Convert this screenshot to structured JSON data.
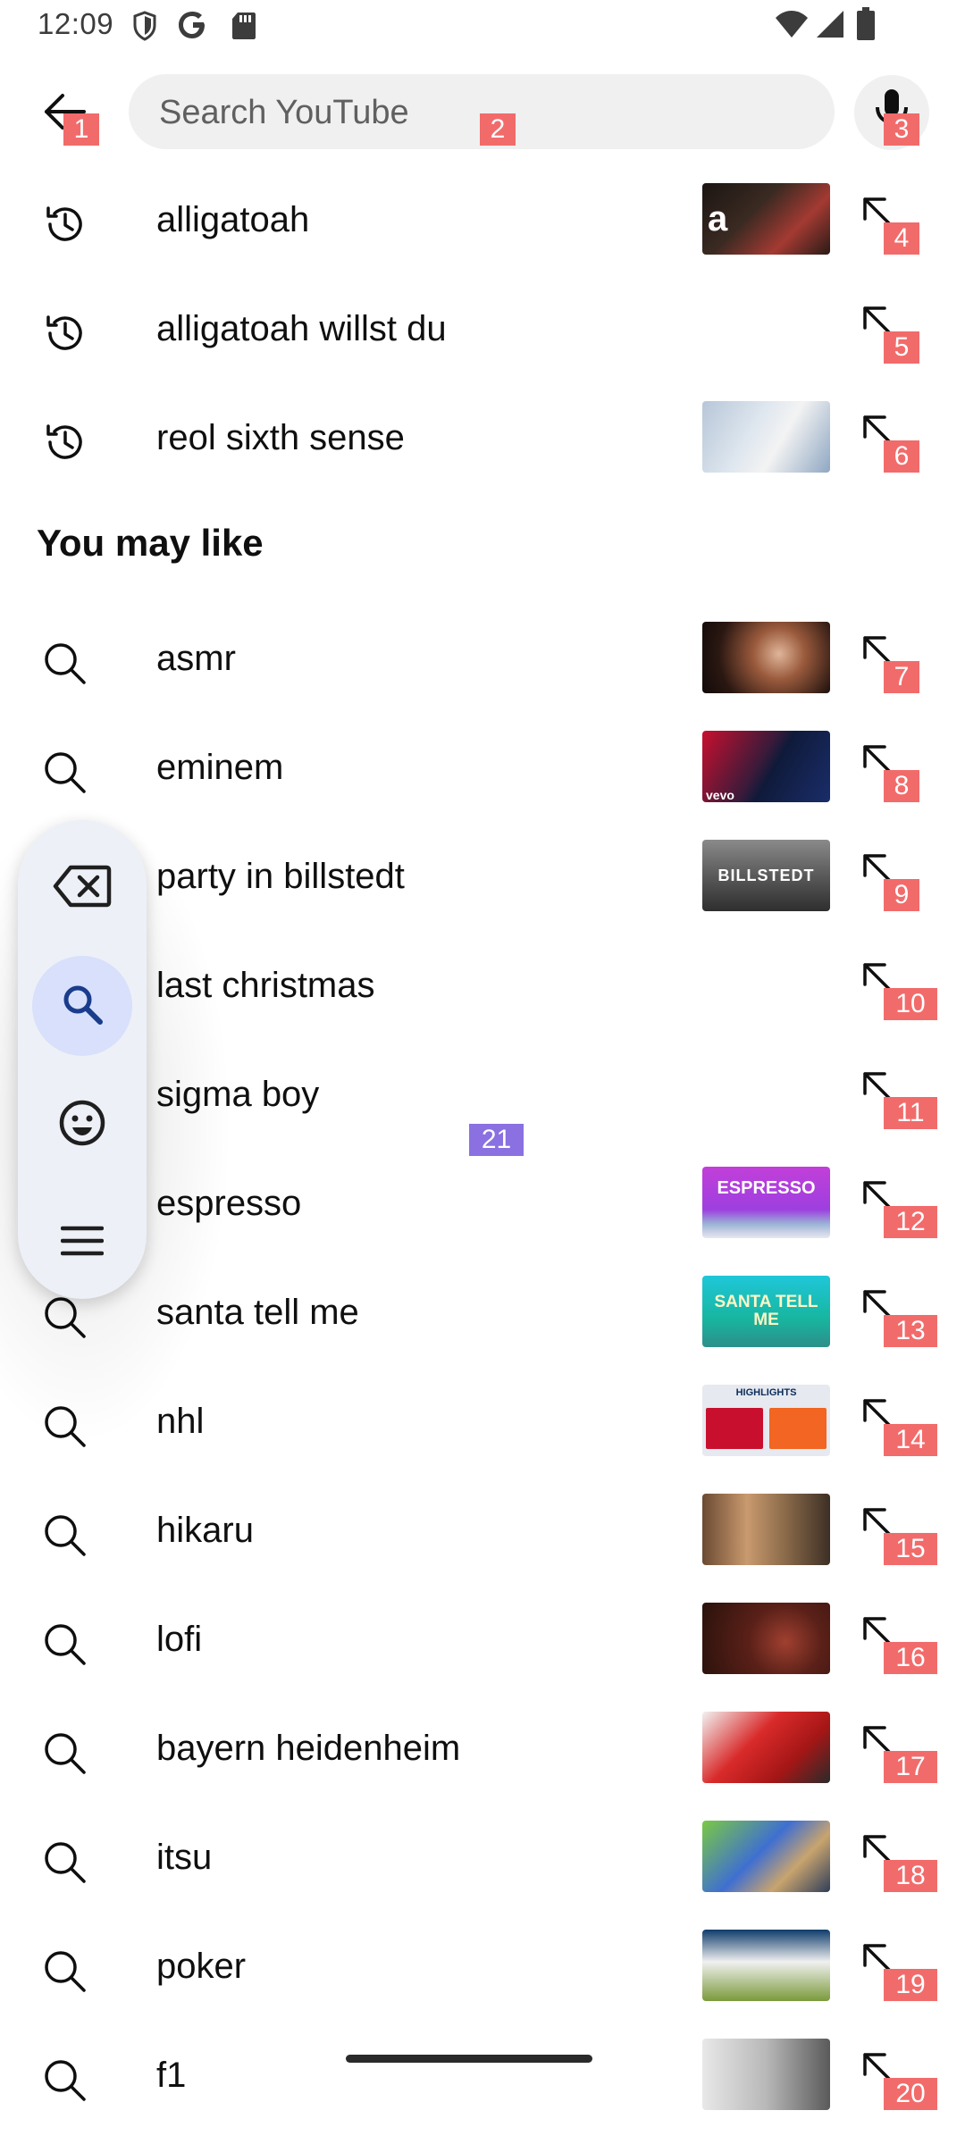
{
  "status_bar": {
    "time": "12:09",
    "left_icons": [
      "shield-icon",
      "google-icon",
      "sd-card-icon"
    ],
    "right_icons": [
      "wifi-icon",
      "signal-icon",
      "battery-icon"
    ]
  },
  "search": {
    "placeholder": "Search YouTube",
    "value": "",
    "back_icon": "arrow-left-icon",
    "mic_icon": "microphone-icon"
  },
  "history": [
    {
      "query": "alligatoah",
      "icon": "history-icon",
      "thumbnail": true,
      "badge": "4"
    },
    {
      "query": "alligatoah willst du",
      "icon": "history-icon",
      "thumbnail": false,
      "badge": "5"
    },
    {
      "query": "reol sixth sense",
      "icon": "history-icon",
      "thumbnail": true,
      "badge": "6"
    }
  ],
  "section_title": "You may like",
  "suggestions": [
    {
      "query": "asmr",
      "icon": "search-icon",
      "thumbnail": true,
      "badge": "7"
    },
    {
      "query": "eminem",
      "icon": "search-icon",
      "thumbnail": true,
      "thumb_text": "vevo",
      "badge": "8"
    },
    {
      "query": "party in billstedt",
      "icon": "search-icon",
      "thumbnail": true,
      "thumb_text": "BILLSTEDT",
      "badge": "9"
    },
    {
      "query": "last christmas",
      "icon": "search-icon",
      "thumbnail": false,
      "badge": "10"
    },
    {
      "query": "sigma boy",
      "icon": "search-icon",
      "thumbnail": false,
      "badge": "11"
    },
    {
      "query": "espresso",
      "icon": "search-icon",
      "thumbnail": true,
      "thumb_text": "ESPRESSO",
      "badge": "12"
    },
    {
      "query": "santa tell me",
      "icon": "search-icon",
      "thumbnail": true,
      "thumb_text": "SANTA TELL ME",
      "badge": "13"
    },
    {
      "query": "nhl",
      "icon": "search-icon",
      "thumbnail": true,
      "thumb_text": "HIGHLIGHTS",
      "badge": "14"
    },
    {
      "query": "hikaru",
      "icon": "search-icon",
      "thumbnail": true,
      "badge": "15"
    },
    {
      "query": "lofi",
      "icon": "search-icon",
      "thumbnail": true,
      "badge": "16"
    },
    {
      "query": "bayern heidenheim",
      "icon": "search-icon",
      "thumbnail": true,
      "badge": "17"
    },
    {
      "query": "itsu",
      "icon": "search-icon",
      "thumbnail": true,
      "badge": "18"
    },
    {
      "query": "poker",
      "icon": "search-icon",
      "thumbnail": true,
      "badge": "19"
    },
    {
      "query": "f1",
      "icon": "search-icon",
      "thumbnail": true,
      "badge": "20"
    }
  ],
  "badges": {
    "back": "1",
    "search": "2",
    "mic": "3",
    "floating": "21"
  },
  "floating_toolbar": {
    "buttons": [
      "backspace-icon",
      "search-icon",
      "emoji-icon",
      "menu-icon"
    ],
    "active_index": 1
  },
  "colors": {
    "badge_red": "#f26b6b",
    "badge_purple": "#8a70e0",
    "search_bg": "#f0f0f0",
    "toolbar_bg": "#eef0f7",
    "toolbar_active": "#d8e0fb",
    "text": "#0f0f0f"
  }
}
